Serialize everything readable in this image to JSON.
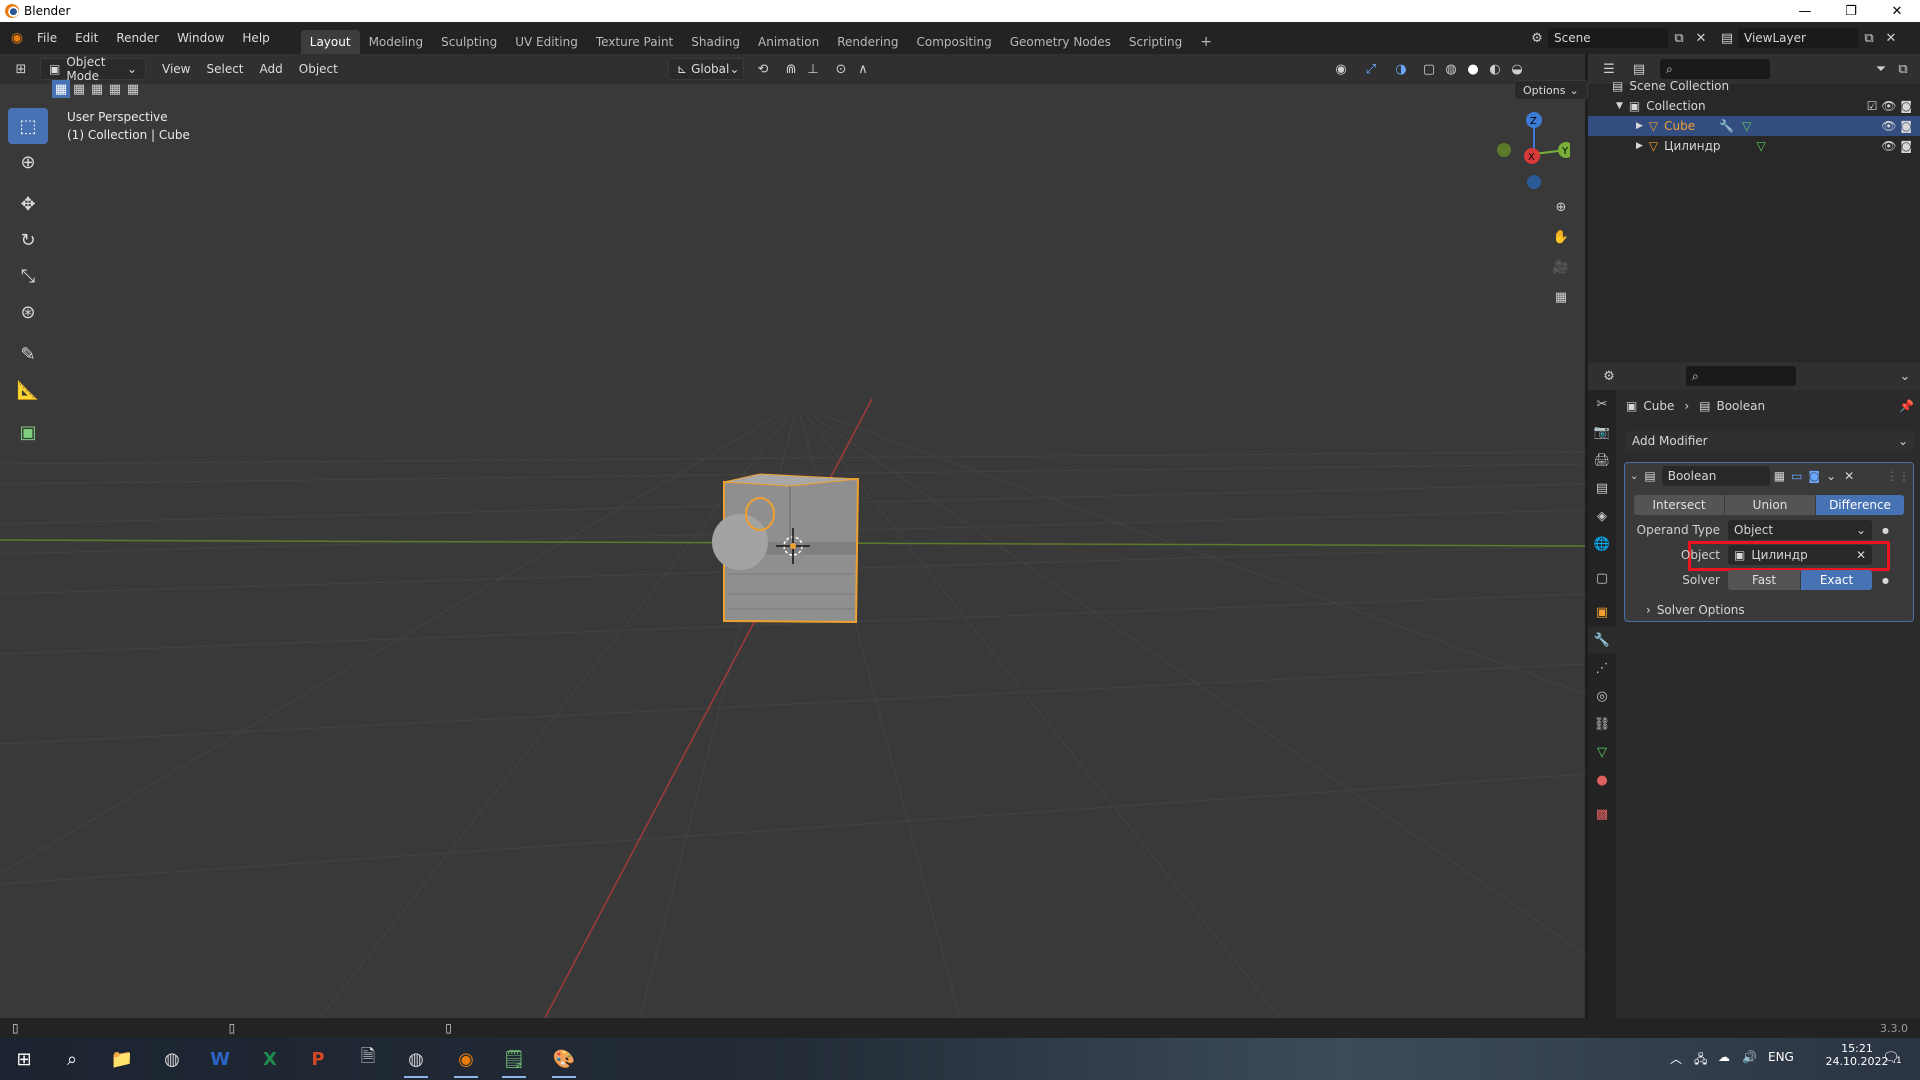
{
  "window": {
    "title": "Blender",
    "controls": [
      "—",
      "❐",
      "✕"
    ]
  },
  "menu": [
    "File",
    "Edit",
    "Render",
    "Window",
    "Help"
  ],
  "workspaces": [
    "Layout",
    "Modeling",
    "Sculpting",
    "UV Editing",
    "Texture Paint",
    "Shading",
    "Animation",
    "Rendering",
    "Compositing",
    "Geometry Nodes",
    "Scripting",
    "+"
  ],
  "active_workspace": "Layout",
  "scene": {
    "name": "Scene",
    "view_layer": "ViewLayer"
  },
  "viewport": {
    "mode": "Object Mode",
    "menus": [
      "View",
      "Select",
      "Add",
      "Object"
    ],
    "transform_orientation": "Global",
    "options_label": "Options",
    "overlay_text_1": "User Perspective",
    "overlay_text_2": "(1) Collection | Cube",
    "gizmo": {
      "x": "X",
      "y": "Y",
      "z": "Z"
    }
  },
  "outliner": {
    "scene_collection": "Scene Collection",
    "collection": "Collection",
    "items": [
      {
        "name": "Cube",
        "selected": true
      },
      {
        "name": "Цилиндр",
        "selected": false
      }
    ]
  },
  "properties": {
    "breadcrumb_object": "Cube",
    "breadcrumb_modifier": "Boolean",
    "add_modifier": "Add Modifier",
    "modifier_name": "Boolean",
    "operations": [
      "Intersect",
      "Union",
      "Difference"
    ],
    "active_operation": "Difference",
    "operand_type_label": "Operand Type",
    "operand_type_value": "Object",
    "object_label": "Object",
    "object_value": "Цилиндр",
    "solver_label": "Solver",
    "solvers": [
      "Fast",
      "Exact"
    ],
    "active_solver": "Exact",
    "solver_options": "Solver Options"
  },
  "status": {
    "version": "3.3.0"
  },
  "taskbar": {
    "lang": "ENG",
    "time": "15:21",
    "date": "24.10.2022",
    "notifications": "1"
  },
  "colors": {
    "accent": "#4772b3",
    "selection": "#e8951c",
    "highlight_box": "#e8141e"
  }
}
